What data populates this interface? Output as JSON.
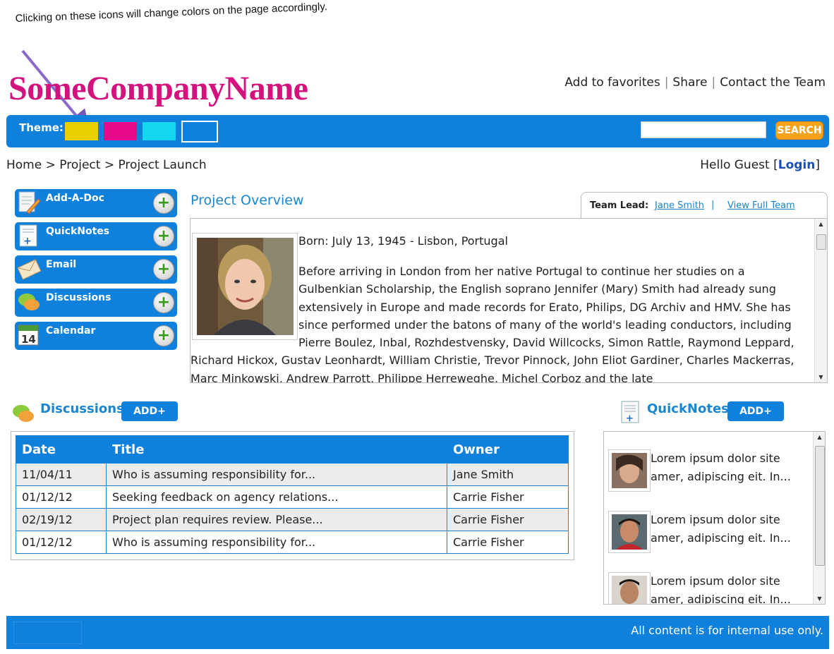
{
  "annotation": "Clicking on these icons will change colors on the page accordingly.",
  "logo": "SomeCompanyName",
  "top_links": [
    "Add to favorites",
    "Share",
    "Contact the Team"
  ],
  "theme": {
    "label": "Theme:",
    "swatches": [
      {
        "name": "yellow",
        "color": "#e8d000"
      },
      {
        "name": "magenta",
        "color": "#e6098c"
      },
      {
        "name": "cyan",
        "color": "#14d6ee"
      },
      {
        "name": "blue",
        "color": "#0f80dc",
        "selected": true
      }
    ]
  },
  "search": {
    "value": "",
    "button": "SEARCH"
  },
  "breadcrumb": "Home > Project > Project Launch",
  "greeting": {
    "text": "Hello Guest",
    "open_bracket": "[",
    "login": "Login",
    "close_bracket": "]"
  },
  "sidebar": {
    "items": [
      {
        "label": "Add-A-Doc",
        "icon": "document-pencil-icon"
      },
      {
        "label": "QuickNotes",
        "icon": "notes-add-icon"
      },
      {
        "label": "Email",
        "icon": "envelope-icon"
      },
      {
        "label": "Discussions",
        "icon": "chat-bubbles-icon"
      },
      {
        "label": "Calendar",
        "icon": "calendar-icon",
        "day": "14"
      }
    ],
    "plus": "+"
  },
  "overview": {
    "title": "Project Overview",
    "team_lead_label": "Team Lead:",
    "team_lead_name": "Jane Smith",
    "separator": "|",
    "view_full_team": "View Full Team",
    "born": "Born: July 13, 1945 - Lisbon, Portugal",
    "bio": "Before arriving in London from her native Portugal to continue her studies on a Gulbenkian Scholarship, the English soprano Jennifer (Mary) Smith had already sung extensively in Europe and made records for Erato, Philips, DG Archiv and HMV. She has since performed under the batons of many of the world's leading conductors, including Pierre Boulez, Inbal, Rozhdestvensky, David Willcocks, Simon Rattle, Raymond Leppard, Richard Hickox, Gustav Leonhardt, William Christie, Trevor Pinnock, John Eliot Gardiner, Charles Mackerras, Marc Minkowski, Andrew Parrott, Philippe Herreweghe, Michel Corboz and the late"
  },
  "discussions": {
    "title": "Discussions",
    "add": "ADD+",
    "columns": [
      "Date",
      "Title",
      "Owner"
    ],
    "rows": [
      [
        "11/04/11",
        "Who is assuming responsibility for...",
        "Jane Smith"
      ],
      [
        "01/12/12",
        "Seeking feedback on agency relations...",
        "Carrie Fisher"
      ],
      [
        "02/19/12",
        "Project plan requires review. Please...",
        "Carrie Fisher"
      ],
      [
        "01/12/12",
        "Who is assuming responsibility for...",
        "Carrie Fisher"
      ]
    ]
  },
  "quicknotes": {
    "title": "QuickNotes",
    "add": "ADD+",
    "items": [
      {
        "text": "Lorem ipsum dolor site amer, adipiscing eit. In..."
      },
      {
        "text": "Lorem ipsum dolor site amer, adipiscing eit. In..."
      },
      {
        "text": "Lorem ipsum dolor site amer, adipiscing eit. In..."
      }
    ]
  },
  "footer": "All content is for internal use only.",
  "colors": {
    "brand_blue": "#0f80dc",
    "logo_magenta": "#d4127e",
    "search_orange": "#f6a21b",
    "link_blue": "#1a86cf"
  }
}
